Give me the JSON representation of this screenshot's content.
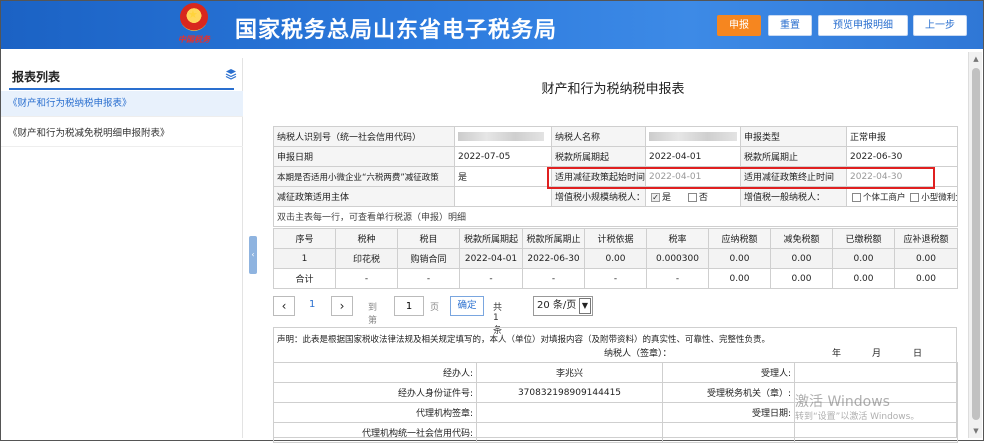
{
  "header": {
    "title": "国家税务总局山东省电子税务局",
    "logo_text": "中国税务",
    "buttons": [
      "申报",
      "重置",
      "预览申报明细",
      "上一步"
    ]
  },
  "sidebar": {
    "title": "报表列表",
    "items": [
      "《财产和行为税纳税申报表》",
      "《财产和行为税减免税明细申报附表》"
    ]
  },
  "form": {
    "title": "财产和行为税纳税申报表",
    "taxpayer_id_label": "纳税人识别号（统一社会信用代码）",
    "taxpayer_name_label": "纳税人名称",
    "declare_type_label": "申报类型",
    "declare_type": "正常申报",
    "declare_date_label": "申报日期",
    "declare_date": "2022-07-05",
    "period_start_label": "税款所属期起",
    "period_start": "2022-04-01",
    "period_end_label": "税款所属期止",
    "period_end": "2022-06-30",
    "six_tax_label": "本期是否适用小微企业“六税两费”减征政策",
    "six_tax_value": "是",
    "policy_start_label": "适用减征政策起始时间",
    "policy_start": "2022-04-01",
    "policy_end_label": "适用减征政策终止时间",
    "policy_end": "2022-04-30",
    "subject_label": "减征政策适用主体",
    "small_scale_label": "增值税小规模纳税人：",
    "opt_yes": "是",
    "opt_no": "否",
    "general_label": "增值税一般纳税人：",
    "opt_individual": "个体工商户",
    "opt_micro": "小型微利企业",
    "hint": "双击主表每一行，可查看单行税源（申报）明细"
  },
  "table": {
    "headers": [
      "序号",
      "税种",
      "税目",
      "税款所属期起",
      "税款所属期止",
      "计税依据",
      "税率",
      "应纳税额",
      "减免税额",
      "已缴税额",
      "应补退税额"
    ],
    "rows": [
      [
        "1",
        "印花税",
        "购销合同",
        "2022-04-01",
        "2022-06-30",
        "0.00",
        "0.000300",
        "0.00",
        "0.00",
        "0.00",
        "0.00"
      ],
      [
        "合计",
        "-",
        "-",
        "-",
        "-",
        "-",
        "-",
        "0.00",
        "0.00",
        "0.00",
        "0.00"
      ]
    ]
  },
  "pager": {
    "current_page": "1",
    "goto_label": "到第",
    "goto_value": "1",
    "page_unit": "页",
    "confirm": "确定",
    "total": "共 1 条",
    "page_size": "20 条/页"
  },
  "declaration": {
    "statement": "声明：此表是根据国家税收法律法规及相关规定填写的，本人（单位）对填报内容（及附带资料）的真实性、可靠性、完整性负责。",
    "signer_label": "纳税人（签章）：",
    "year": "年",
    "month": "月",
    "day": "日",
    "agent_label": "经办人:",
    "agent_name": "李兆兴",
    "receiver_label": "受理人:",
    "agent_id_label": "经办人身份证件号:",
    "agent_id": "370832198909144415",
    "tax_office_label": "受理税务机关（章）:",
    "agency_seal_label": "代理机构签章:",
    "accept_date_label": "受理日期:",
    "agency_credit_label": "代理机构统一社会信用代码:"
  },
  "watermark": {
    "line1": "激活 Windows",
    "line2": "转到“设置”以激活 Windows。"
  }
}
